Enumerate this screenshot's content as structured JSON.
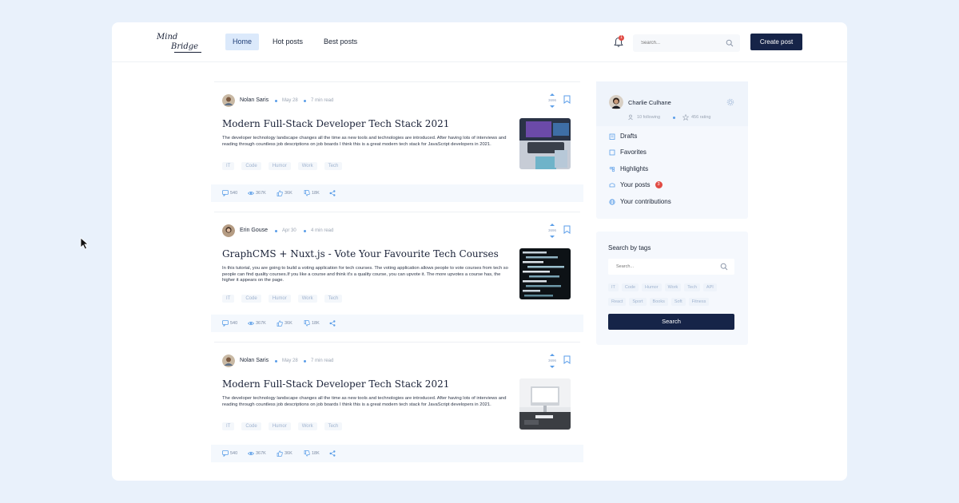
{
  "header": {
    "logo_line1": "Mind",
    "logo_line2": "Bridge",
    "tabs": [
      {
        "label": "Home",
        "active": true
      },
      {
        "label": "Hot posts",
        "active": false
      },
      {
        "label": "Best posts",
        "active": false
      }
    ],
    "notification_count": "1",
    "search_placeholder": "Search...",
    "create_label": "Create post"
  },
  "posts": [
    {
      "author": "Nolan Saris",
      "date": "May 28",
      "read_time": "7 min read",
      "votes": "3696",
      "title": "Modern Full-Stack Developer Tech Stack 2021",
      "description": "The developer technology landscape changes all the time as new tools and technologies are introduced. After having lots of interviews and reading through countless job descriptions on job boards I think this is a great modern tech stack for JavaScript developers in 2021.",
      "tags": [
        "IT",
        "Code",
        "Humor",
        "Work",
        "Tech"
      ],
      "comments": "540",
      "views": "367K",
      "likes": "36K",
      "dislikes": "18K",
      "thumb": "laptop-desk"
    },
    {
      "author": "Erin Gouse",
      "date": "Apr 30",
      "read_time": "4 min read",
      "votes": "3696",
      "title": "GraphCMS + Nuxt.js - Vote Your Favourite Tech Courses",
      "description": "In this tutorial, you are going to build a voting application for tech courses. The voting application allows people to vote courses from tech so people can find quality courses.If you like a course and think it's a quality course, you can upvote it. The more upvotes a course has, the higher it appears on the page.",
      "tags": [
        "IT",
        "Code",
        "Humor",
        "Work",
        "Tech"
      ],
      "comments": "540",
      "views": "367K",
      "likes": "36K",
      "dislikes": "18K",
      "thumb": "code-screen"
    },
    {
      "author": "Nolan Saris",
      "date": "May 28",
      "read_time": "7 min read",
      "votes": "3696",
      "title": "Modern Full-Stack Developer Tech Stack 2021",
      "description": "The developer technology landscape changes all the time as new tools and technologies are introduced. After having lots of interviews and reading through countless job descriptions on job boards I think this is a great modern tech stack for JavaScript developers in 2021.",
      "tags": [
        "IT",
        "Code",
        "Humor",
        "Work",
        "Tech"
      ],
      "comments": "540",
      "views": "367K",
      "likes": "36K",
      "dislikes": "18K",
      "thumb": "imac-desk"
    }
  ],
  "profile": {
    "name": "Charlie Culhane",
    "following": "10 following",
    "rating": "456 rating",
    "menu": [
      {
        "label": "Drafts",
        "icon": "clipboard-icon"
      },
      {
        "label": "Favorites",
        "icon": "bookmark-icon"
      },
      {
        "label": "Highlights",
        "icon": "highlight-icon"
      },
      {
        "label": "Your posts",
        "icon": "posts-icon",
        "count": "3"
      },
      {
        "label": "Your contributions",
        "icon": "globe-icon"
      }
    ]
  },
  "tag_search": {
    "title": "Search by tags",
    "placeholder": "Search...",
    "tags_row1": [
      "IT",
      "Code",
      "Humor",
      "Work",
      "Tech",
      "API"
    ],
    "tags_row2": [
      "React",
      "Sport",
      "Books",
      "Soft",
      "Fitness"
    ],
    "button_label": "Search"
  },
  "colors": {
    "accent": "#162448",
    "link_blue": "#5b9ee8",
    "background": "#e9f1fb",
    "badge": "#e14b44"
  }
}
